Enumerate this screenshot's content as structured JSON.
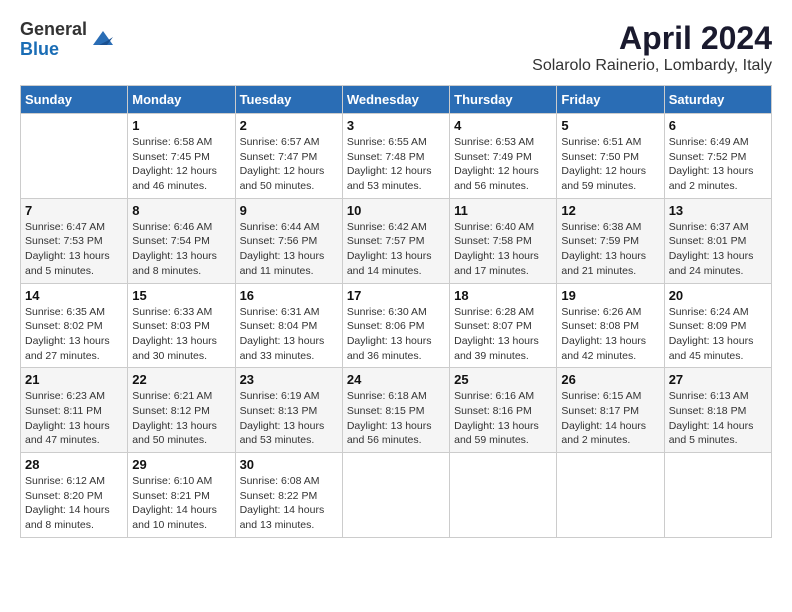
{
  "header": {
    "logo_line1": "General",
    "logo_line2": "Blue",
    "title": "April 2024",
    "subtitle": "Solarolo Rainerio, Lombardy, Italy"
  },
  "calendar": {
    "headers": [
      "Sunday",
      "Monday",
      "Tuesday",
      "Wednesday",
      "Thursday",
      "Friday",
      "Saturday"
    ],
    "weeks": [
      [
        {
          "day": "",
          "info": ""
        },
        {
          "day": "1",
          "info": "Sunrise: 6:58 AM\nSunset: 7:45 PM\nDaylight: 12 hours\nand 46 minutes."
        },
        {
          "day": "2",
          "info": "Sunrise: 6:57 AM\nSunset: 7:47 PM\nDaylight: 12 hours\nand 50 minutes."
        },
        {
          "day": "3",
          "info": "Sunrise: 6:55 AM\nSunset: 7:48 PM\nDaylight: 12 hours\nand 53 minutes."
        },
        {
          "day": "4",
          "info": "Sunrise: 6:53 AM\nSunset: 7:49 PM\nDaylight: 12 hours\nand 56 minutes."
        },
        {
          "day": "5",
          "info": "Sunrise: 6:51 AM\nSunset: 7:50 PM\nDaylight: 12 hours\nand 59 minutes."
        },
        {
          "day": "6",
          "info": "Sunrise: 6:49 AM\nSunset: 7:52 PM\nDaylight: 13 hours\nand 2 minutes."
        }
      ],
      [
        {
          "day": "7",
          "info": "Sunrise: 6:47 AM\nSunset: 7:53 PM\nDaylight: 13 hours\nand 5 minutes."
        },
        {
          "day": "8",
          "info": "Sunrise: 6:46 AM\nSunset: 7:54 PM\nDaylight: 13 hours\nand 8 minutes."
        },
        {
          "day": "9",
          "info": "Sunrise: 6:44 AM\nSunset: 7:56 PM\nDaylight: 13 hours\nand 11 minutes."
        },
        {
          "day": "10",
          "info": "Sunrise: 6:42 AM\nSunset: 7:57 PM\nDaylight: 13 hours\nand 14 minutes."
        },
        {
          "day": "11",
          "info": "Sunrise: 6:40 AM\nSunset: 7:58 PM\nDaylight: 13 hours\nand 17 minutes."
        },
        {
          "day": "12",
          "info": "Sunrise: 6:38 AM\nSunset: 7:59 PM\nDaylight: 13 hours\nand 21 minutes."
        },
        {
          "day": "13",
          "info": "Sunrise: 6:37 AM\nSunset: 8:01 PM\nDaylight: 13 hours\nand 24 minutes."
        }
      ],
      [
        {
          "day": "14",
          "info": "Sunrise: 6:35 AM\nSunset: 8:02 PM\nDaylight: 13 hours\nand 27 minutes."
        },
        {
          "day": "15",
          "info": "Sunrise: 6:33 AM\nSunset: 8:03 PM\nDaylight: 13 hours\nand 30 minutes."
        },
        {
          "day": "16",
          "info": "Sunrise: 6:31 AM\nSunset: 8:04 PM\nDaylight: 13 hours\nand 33 minutes."
        },
        {
          "day": "17",
          "info": "Sunrise: 6:30 AM\nSunset: 8:06 PM\nDaylight: 13 hours\nand 36 minutes."
        },
        {
          "day": "18",
          "info": "Sunrise: 6:28 AM\nSunset: 8:07 PM\nDaylight: 13 hours\nand 39 minutes."
        },
        {
          "day": "19",
          "info": "Sunrise: 6:26 AM\nSunset: 8:08 PM\nDaylight: 13 hours\nand 42 minutes."
        },
        {
          "day": "20",
          "info": "Sunrise: 6:24 AM\nSunset: 8:09 PM\nDaylight: 13 hours\nand 45 minutes."
        }
      ],
      [
        {
          "day": "21",
          "info": "Sunrise: 6:23 AM\nSunset: 8:11 PM\nDaylight: 13 hours\nand 47 minutes."
        },
        {
          "day": "22",
          "info": "Sunrise: 6:21 AM\nSunset: 8:12 PM\nDaylight: 13 hours\nand 50 minutes."
        },
        {
          "day": "23",
          "info": "Sunrise: 6:19 AM\nSunset: 8:13 PM\nDaylight: 13 hours\nand 53 minutes."
        },
        {
          "day": "24",
          "info": "Sunrise: 6:18 AM\nSunset: 8:15 PM\nDaylight: 13 hours\nand 56 minutes."
        },
        {
          "day": "25",
          "info": "Sunrise: 6:16 AM\nSunset: 8:16 PM\nDaylight: 13 hours\nand 59 minutes."
        },
        {
          "day": "26",
          "info": "Sunrise: 6:15 AM\nSunset: 8:17 PM\nDaylight: 14 hours\nand 2 minutes."
        },
        {
          "day": "27",
          "info": "Sunrise: 6:13 AM\nSunset: 8:18 PM\nDaylight: 14 hours\nand 5 minutes."
        }
      ],
      [
        {
          "day": "28",
          "info": "Sunrise: 6:12 AM\nSunset: 8:20 PM\nDaylight: 14 hours\nand 8 minutes."
        },
        {
          "day": "29",
          "info": "Sunrise: 6:10 AM\nSunset: 8:21 PM\nDaylight: 14 hours\nand 10 minutes."
        },
        {
          "day": "30",
          "info": "Sunrise: 6:08 AM\nSunset: 8:22 PM\nDaylight: 14 hours\nand 13 minutes."
        },
        {
          "day": "",
          "info": ""
        },
        {
          "day": "",
          "info": ""
        },
        {
          "day": "",
          "info": ""
        },
        {
          "day": "",
          "info": ""
        }
      ]
    ]
  }
}
